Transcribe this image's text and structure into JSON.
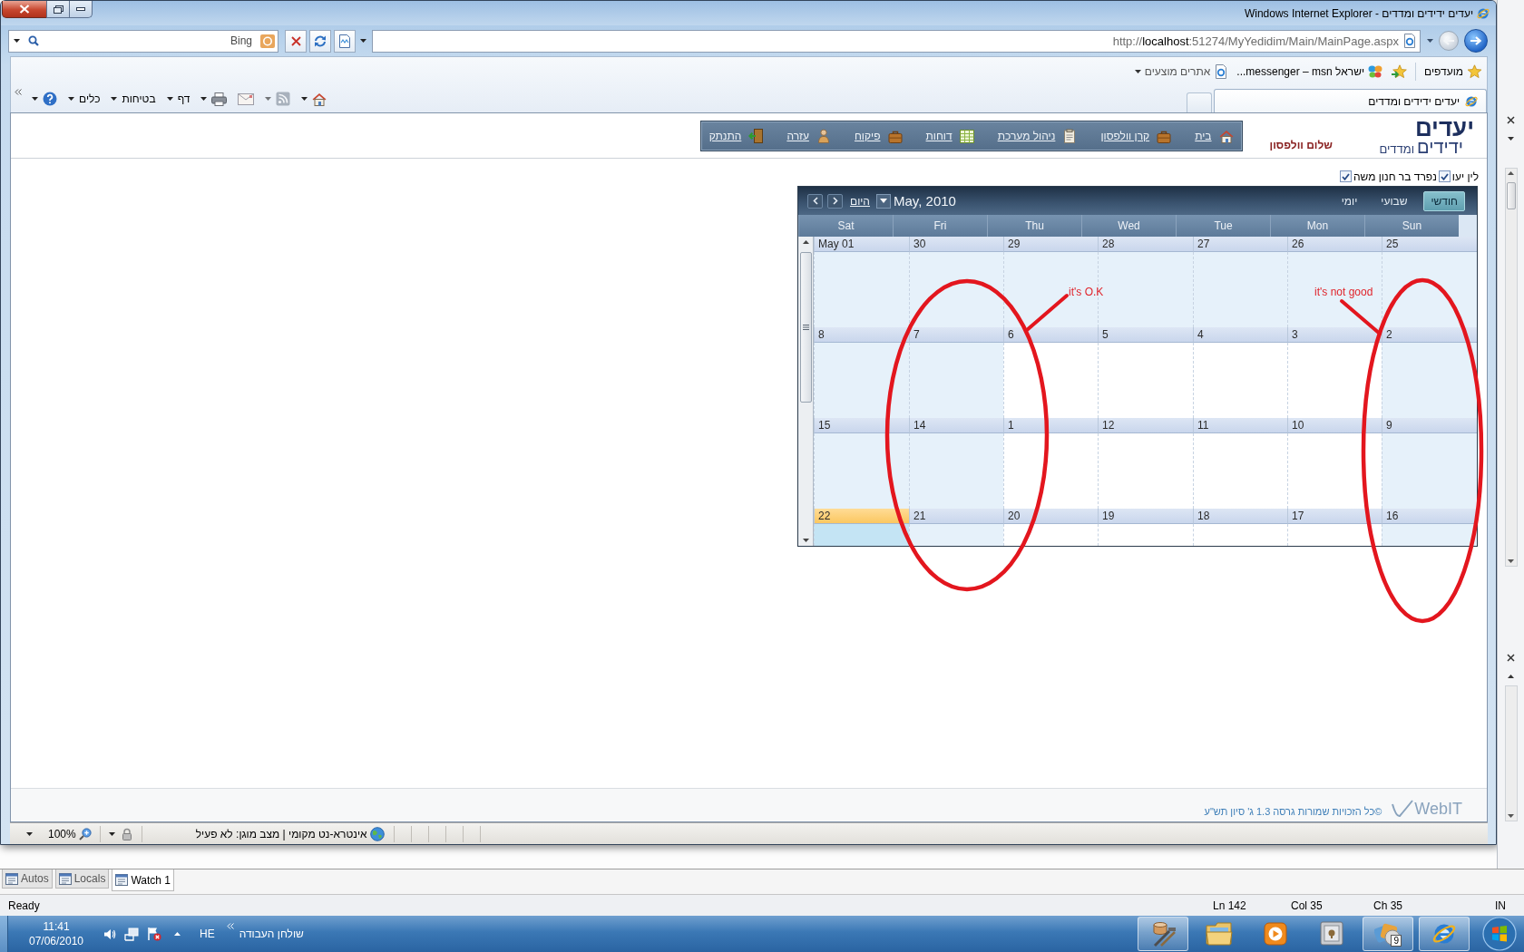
{
  "window": {
    "title": "יעדים ידידים ומדדים - Windows Internet Explorer"
  },
  "search": {
    "provider": "Bing"
  },
  "address_bar": {
    "url": "http://**localhost**:51274/MyYedidim/Main/MainPage.aspx"
  },
  "nav_buttons": [
    {
      "kind": "back",
      "disabled": false
    },
    {
      "kind": "forward",
      "disabled": true
    }
  ],
  "favorites_bar": {
    "favorites_label": "מועדפים",
    "links": [
      {
        "kind": "msn",
        "label": "...messenger – msn ישראל",
        "has_menu": false
      },
      {
        "kind": "page",
        "label": "אתרים מוצעים",
        "has_menu": true
      }
    ]
  },
  "tabs": [
    {
      "label": "יעדים ידידים ומדדים",
      "selected": true
    }
  ],
  "command_bar": [
    {
      "kind": "home",
      "has_menu": true,
      "disabled": false
    },
    {
      "kind": "feeds",
      "has_menu": true,
      "disabled": true
    },
    {
      "kind": "mail",
      "has_menu": false,
      "disabled": false
    },
    {
      "kind": "print",
      "has_menu": true,
      "disabled": false
    },
    {
      "kind": "menu",
      "label": "דף",
      "has_menu": true,
      "disabled": false
    },
    {
      "kind": "menu",
      "label": "בטיחות",
      "has_menu": true,
      "disabled": false
    },
    {
      "kind": "menu",
      "label": "כלים",
      "has_menu": true,
      "disabled": false
    },
    {
      "kind": "help",
      "has_menu": true,
      "disabled": false
    }
  ],
  "page": {
    "logo": {
      "words": [
        "יעדים",
        "ידידים",
        "ומדדים"
      ]
    },
    "greeting": "שלום וולפסון",
    "nav": [
      {
        "kind": "home",
        "label": "בית"
      },
      {
        "kind": "briefcase",
        "label": "קרן וולפסון"
      },
      {
        "kind": "clipboard",
        "label": "ניהול מערכת"
      },
      {
        "kind": "table",
        "label": "דוחות"
      },
      {
        "kind": "briefcase",
        "label": "פיקוח"
      },
      {
        "kind": "person",
        "label": "עזרה"
      },
      {
        "kind": "exit",
        "label": "התנתק"
      }
    ],
    "filters": [
      {
        "label": "לין יעו",
        "checked": true
      },
      {
        "label": "נפרד בר חנון משה",
        "checked": true
      }
    ],
    "calendar": {
      "title": "May, 2010",
      "today_link": "היום",
      "views": [
        {
          "label": "חודשי",
          "selected": true
        },
        {
          "label": "שבועי",
          "selected": false
        },
        {
          "label": "יומי",
          "selected": false
        }
      ],
      "day_names": [
        "Sun",
        "Mon",
        "Tue",
        "Wed",
        "Thu",
        "Fri",
        "Sat"
      ],
      "weeks": [
        {
          "days": [
            {
              "date": "25",
              "shaded": true,
              "selected": false
            },
            {
              "date": "26",
              "shaded": true,
              "selected": false
            },
            {
              "date": "27",
              "shaded": true,
              "selected": false
            },
            {
              "date": "28",
              "shaded": true,
              "selected": false
            },
            {
              "date": "29",
              "shaded": true,
              "selected": false
            },
            {
              "date": "30",
              "shaded": true,
              "selected": false
            },
            {
              "date": "May 01",
              "shaded": true,
              "selected": false
            }
          ]
        },
        {
          "days": [
            {
              "date": "2",
              "shaded": true,
              "selected": false
            },
            {
              "date": "3",
              "shaded": false,
              "selected": false
            },
            {
              "date": "4",
              "shaded": false,
              "selected": false
            },
            {
              "date": "5",
              "shaded": false,
              "selected": false
            },
            {
              "date": "6",
              "shaded": false,
              "selected": false
            },
            {
              "date": "7",
              "shaded": true,
              "selected": false
            },
            {
              "date": "8",
              "shaded": true,
              "selected": false
            }
          ]
        },
        {
          "days": [
            {
              "date": "9",
              "shaded": true,
              "selected": false
            },
            {
              "date": "10",
              "shaded": false,
              "selected": false
            },
            {
              "date": "11",
              "shaded": false,
              "selected": false
            },
            {
              "date": "12",
              "shaded": false,
              "selected": false
            },
            {
              "date": "1",
              "shaded": false,
              "selected": false
            },
            {
              "date": "14",
              "shaded": true,
              "selected": false
            },
            {
              "date": "15",
              "shaded": true,
              "selected": false
            }
          ]
        },
        {
          "days": [
            {
              "date": "16",
              "shaded": true,
              "selected": false
            },
            {
              "date": "17",
              "shaded": false,
              "selected": false
            },
            {
              "date": "18",
              "shaded": false,
              "selected": false
            },
            {
              "date": "19",
              "shaded": false,
              "selected": false
            },
            {
              "date": "20",
              "shaded": false,
              "selected": false
            },
            {
              "date": "21",
              "shaded": true,
              "selected": false
            },
            {
              "date": "22",
              "shaded": true,
              "selected": true
            }
          ]
        }
      ]
    },
    "annotations": [
      {
        "text": "it's not good"
      },
      {
        "text": "it's O.K"
      }
    ],
    "footer": {
      "brand": "WebIT",
      "copyright": "©כל הזכויות שמורות גרסה 1.3 ג' סיון תש\"ע"
    }
  },
  "status_bar": {
    "zoom": "100%",
    "zone": "אינטרא-נט מקומי | מצב מוגן: לא פעיל"
  },
  "debug_tabs": [
    {
      "label": "Watch 1",
      "selected": true
    },
    {
      "label": "Locals",
      "selected": false
    },
    {
      "label": "Autos",
      "selected": false
    }
  ],
  "ide_status": {
    "message": "Ready",
    "line": "Ln 142",
    "column": "Col 35",
    "char": "Ch 35",
    "mode": "IN"
  },
  "taskbar": {
    "time": "11:41",
    "date": "07/06/2010",
    "language": "HE",
    "toolbar": "שולחן העבודה",
    "apps": [
      {
        "kind": "browser",
        "active": true
      },
      {
        "kind": "group",
        "active": true,
        "badge": "9"
      },
      {
        "kind": "safe",
        "active": false
      },
      {
        "kind": "media",
        "active": false
      },
      {
        "kind": "folder",
        "active": false
      },
      {
        "kind": "tools",
        "active": true
      }
    ]
  }
}
